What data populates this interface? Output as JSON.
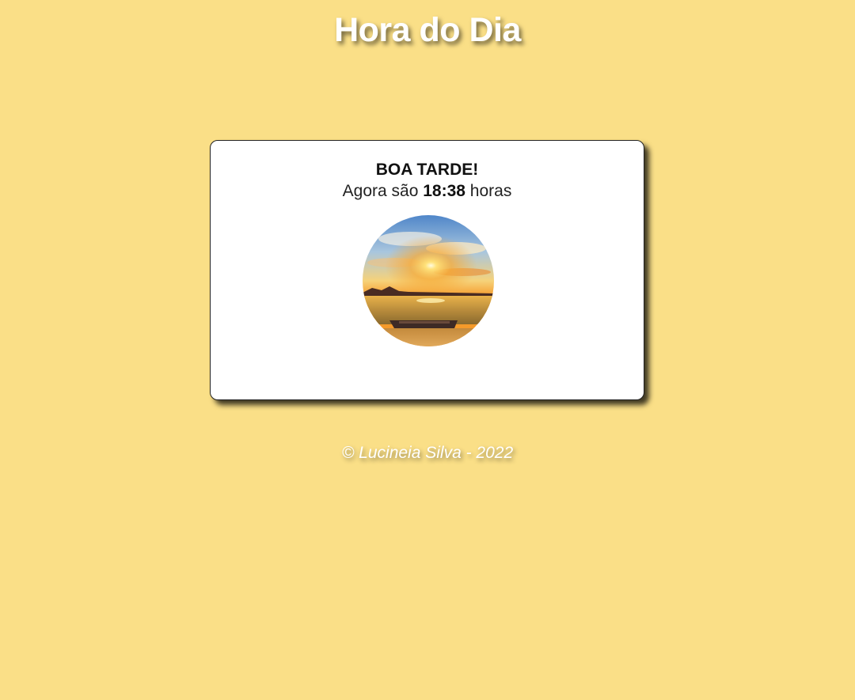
{
  "header": {
    "title": "Hora do Dia"
  },
  "card": {
    "greeting": "BOA TARDE!",
    "time_prefix": "Agora são",
    "time_value": "18:38",
    "time_suffix": "horas",
    "image": {
      "icon": "sunset-beach-photo"
    }
  },
  "footer": {
    "text": "© Lucineia Silva - 2022"
  },
  "colors": {
    "background": "#fadf87",
    "card": "#ffffff",
    "title": "#ffffff"
  }
}
